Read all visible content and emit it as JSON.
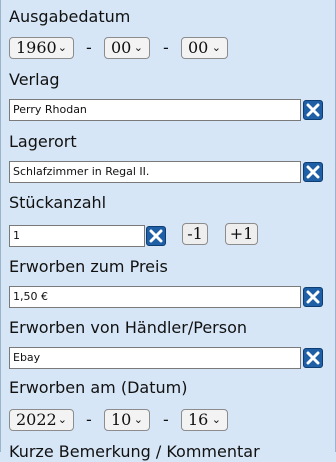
{
  "ausgabedatum": {
    "label": "Ausgabedatum",
    "year": "1960",
    "month": "00",
    "day": "00",
    "separator": "-"
  },
  "verlag": {
    "label": "Verlag",
    "value": "Perry Rhodan"
  },
  "lagerort": {
    "label": "Lagerort",
    "value": "Schlafzimmer in Regal II."
  },
  "stueckanzahl": {
    "label": "Stückanzahl",
    "value": "1",
    "minus_label": "-1",
    "plus_label": "+1"
  },
  "preis": {
    "label": "Erworben zum Preis",
    "value": "1,50 €"
  },
  "haendler": {
    "label": "Erworben von Händler/Person",
    "value": "Ebay"
  },
  "erworben_am": {
    "label": "Erworben am (Datum)",
    "year": "2022",
    "month": "10",
    "day": "16",
    "separator": "-"
  },
  "bemerkung": {
    "label": "Kurze Bemerkung / Kommentar"
  },
  "icons": {
    "chevron": "chevron-down-icon",
    "clear": "clear-x-icon"
  },
  "colors": {
    "background": "#d6e6f7",
    "clear_button": "#1f5fa6"
  }
}
